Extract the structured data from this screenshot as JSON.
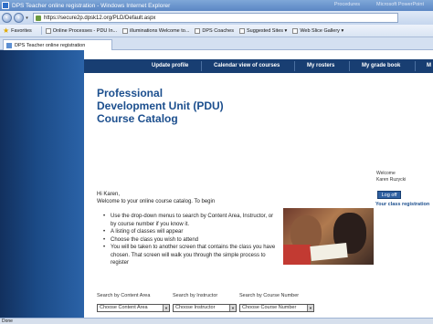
{
  "window": {
    "title": "DPS Teacher online registration - Windows Internet Explorer",
    "right_tabs": [
      "Procedures",
      "Microsoft PowerPoint"
    ]
  },
  "address": {
    "url": "https://secure2p.dpsk12.org/PLD/Default.aspx"
  },
  "favorites": {
    "label": "Favorites",
    "items": [
      "Online Processes - PDU In...",
      "illuminations Welcome to...",
      "DPS Coaches",
      "Suggested Sites ▾",
      "Web Slice Gallery ▾"
    ]
  },
  "tab": {
    "label": "DPS Teacher online registration"
  },
  "nav": {
    "items": [
      "Update profile",
      "Calendar view of courses",
      "My rosters",
      "My grade book",
      "M"
    ]
  },
  "page": {
    "heading_lines": [
      "Professional",
      "Development Unit (PDU)",
      "Course Catalog"
    ],
    "greeting": "Hi Karen,",
    "intro": "Welcome to your online course catalog. To begin",
    "instructions": [
      "Use the drop-down menus to search by Content Area, Instructor, or by course number if you know it.",
      "A listing of classes will appear",
      "Choose the class you wish to attend",
      "You will be taken to another screen that contains the class you have chosen. That screen will walk you through the simple process to register"
    ],
    "search": {
      "content_label": "Search by Content Area",
      "instructor_label": "Search by Instructor",
      "number_label": "Search by Course Number",
      "content_value": "Choose Content Area",
      "instructor_value": "Choose Instructor",
      "number_value": "Choose Course Number"
    }
  },
  "user": {
    "welcome": "Welcome",
    "name": "Karen Ruzycki",
    "logoff": "Log off",
    "registration": "Your class registration"
  },
  "status": {
    "text": "Done"
  }
}
